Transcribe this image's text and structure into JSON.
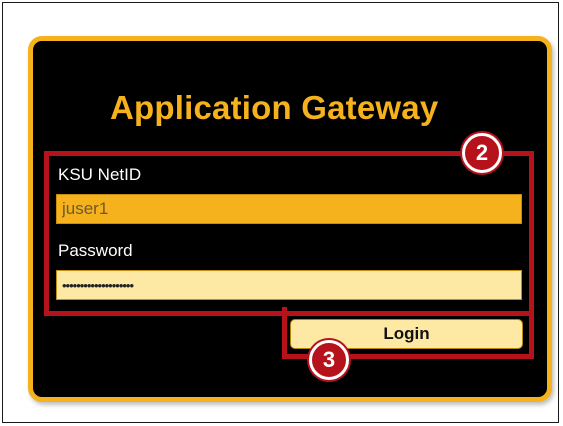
{
  "gateway": {
    "title": "Application Gateway"
  },
  "fields": {
    "netid_label": "KSU NetID",
    "netid_value": "juser1",
    "password_label": "Password",
    "password_masked": "••••••••••••••••••••"
  },
  "actions": {
    "login_label": "Login"
  },
  "callouts": {
    "fields_step": "2",
    "login_step": "3"
  },
  "colors": {
    "accent": "#f6b21c",
    "panel_background": "#000000",
    "callout": "#b5121b",
    "input_light": "#fde9a3"
  }
}
